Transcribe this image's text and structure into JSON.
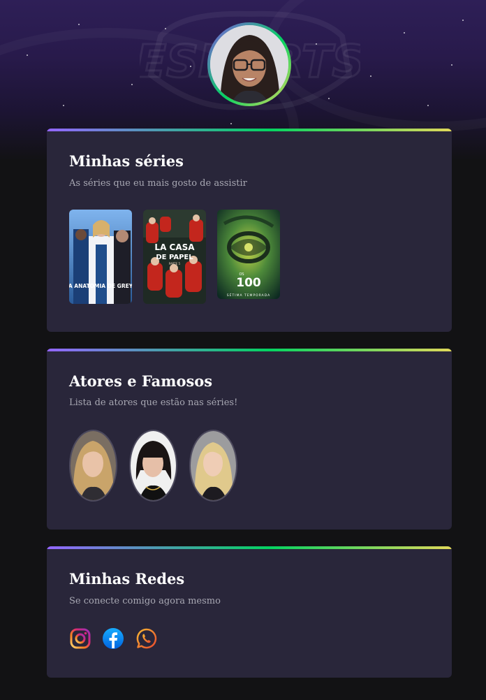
{
  "profile": {
    "avatar_alt": "avatar"
  },
  "series_section": {
    "title": "Minhas séries",
    "subtitle": "As séries que eu mais gosto de assistir",
    "posters": [
      {
        "caption": "A ANATOMIA DE GREY"
      },
      {
        "caption_top": "LA CASA",
        "caption_bottom": "DE PAPEL",
        "caption_small": "PARTE 5"
      },
      {
        "caption_small": "OS",
        "caption": "100",
        "caption_bottom": "SÉTIMA TEMPORADA"
      }
    ]
  },
  "actors_section": {
    "title": "Atores e Famosos",
    "subtitle": "Lista de atores que estão nas séries!"
  },
  "social_section": {
    "title": "Minhas Redes",
    "subtitle": "Se conecte comigo agora mesmo",
    "links": [
      {
        "icon": "instagram-icon"
      },
      {
        "icon": "facebook-icon"
      },
      {
        "icon": "whatsapp-icon"
      }
    ]
  },
  "colors": {
    "background": "#121214",
    "card": "#29263a",
    "gradient_start": "#9466ff",
    "gradient_mid": "#04d361",
    "gradient_end": "#e1d95a",
    "title": "#ffffff",
    "subtitle": "#a8a8b3"
  }
}
